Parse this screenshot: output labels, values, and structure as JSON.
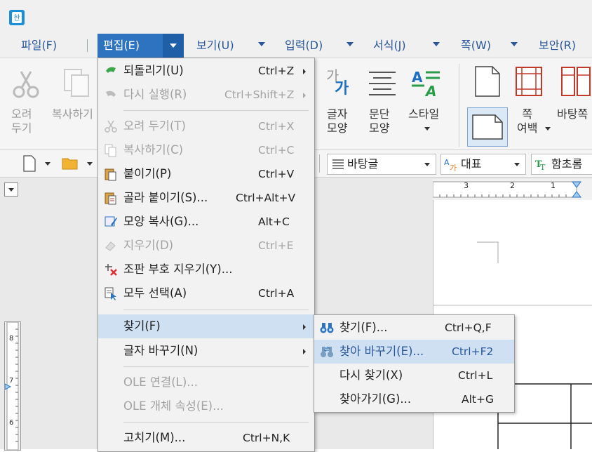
{
  "menubar": {
    "file": "파일(F)",
    "edit": "편집(E)",
    "view": "보기(U)",
    "insert": "입력(D)",
    "format": "서식(J)",
    "page": "쪽(W)",
    "security": "보안(R)"
  },
  "ribbon": {
    "cut_label": "오려\n두기",
    "copy_label": "복사하기",
    "char_shape": "글자\n모양",
    "para_shape": "문단\n모양",
    "style": "스타일",
    "page_margin": "쪽\n여백",
    "background": "바탕쪽"
  },
  "toolbar2": {
    "style_combo": "바탕글",
    "lang_combo": "대표",
    "font_combo": "함초롬"
  },
  "edit_menu": {
    "items": [
      {
        "label": "되돌리기(U)",
        "shortcut": "Ctrl+Z",
        "enabled": true,
        "submenu": true,
        "icon": "undo-icon"
      },
      {
        "label": "다시 실행(R)",
        "shortcut": "Ctrl+Shift+Z",
        "enabled": false,
        "submenu": true,
        "icon": "redo-icon"
      },
      {
        "label": "오려 두기(T)",
        "shortcut": "Ctrl+X",
        "enabled": false,
        "icon": "scissors-icon"
      },
      {
        "label": "복사하기(C)",
        "shortcut": "Ctrl+C",
        "enabled": false,
        "icon": "copy-icon"
      },
      {
        "label": "붙이기(P)",
        "shortcut": "Ctrl+V",
        "enabled": true,
        "icon": "paste-icon"
      },
      {
        "label": "골라 붙이기(S)...",
        "shortcut": "Ctrl+Alt+V",
        "enabled": true,
        "icon": "paste-special-icon"
      },
      {
        "label": "모양 복사(G)...",
        "shortcut": "Alt+C",
        "enabled": true,
        "icon": "format-painter-icon"
      },
      {
        "label": "지우기(D)",
        "shortcut": "Ctrl+E",
        "enabled": false,
        "icon": "eraser-icon"
      },
      {
        "label": "조판 부호 지우기(Y)...",
        "shortcut": "",
        "enabled": true,
        "icon": "clear-codes-icon"
      },
      {
        "label": "모두 선택(A)",
        "shortcut": "Ctrl+A",
        "enabled": true,
        "icon": "select-all-icon"
      },
      {
        "label": "찾기(F)",
        "shortcut": "",
        "enabled": true,
        "submenu": true,
        "highlighted": true
      },
      {
        "label": "글자 바꾸기(N)",
        "shortcut": "",
        "enabled": true,
        "submenu": true
      },
      {
        "label": "OLE 연결(L)...",
        "shortcut": "",
        "enabled": false
      },
      {
        "label": "OLE 개체 속성(E)...",
        "shortcut": "",
        "enabled": false
      },
      {
        "label": "고치기(M)...",
        "shortcut": "Ctrl+N,K",
        "enabled": true
      }
    ]
  },
  "find_menu": {
    "items": [
      {
        "label": "찾기(F)...",
        "shortcut": "Ctrl+Q,F",
        "icon": "binoculars-icon"
      },
      {
        "label": "찾아 바꾸기(E)...",
        "shortcut": "Ctrl+F2",
        "icon": "find-replace-icon",
        "highlighted": true
      },
      {
        "label": "다시 찾기(X)",
        "shortcut": "Ctrl+L"
      },
      {
        "label": "찾아가기(G)...",
        "shortcut": "Alt+G"
      }
    ]
  },
  "ruler": {
    "h_ticks": [
      "3",
      "2",
      "1"
    ],
    "v_ticks": [
      "8",
      "7",
      "6"
    ]
  },
  "colors": {
    "accent": "#2e73c0",
    "menu_text": "#2b579a",
    "highlight": "#cfe0f3"
  }
}
